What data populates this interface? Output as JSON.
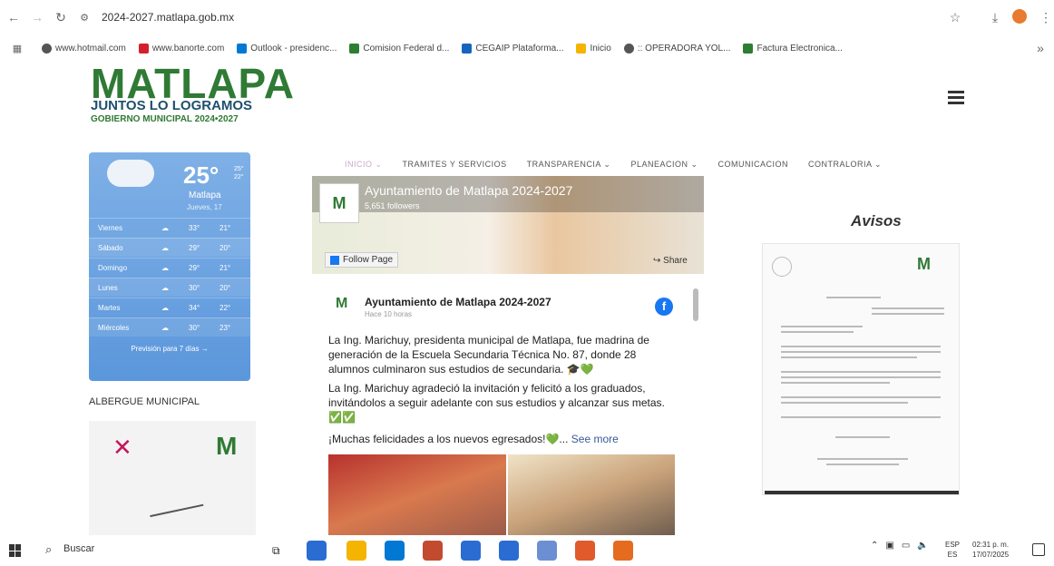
{
  "browser": {
    "url": "2024-2027.matlapa.gob.mx",
    "bookmarks": [
      {
        "label": "www.hotmail.com",
        "color": "#555555"
      },
      {
        "label": "www.banorte.com",
        "color": "#d4202c"
      },
      {
        "label": "Outlook - presidenc...",
        "color": "#0078d4"
      },
      {
        "label": "Comision Federal d...",
        "color": "#2e7d32"
      },
      {
        "label": "CEGAIP Plataforma...",
        "color": "#1565c0"
      },
      {
        "label": "Inicio",
        "color": "#f4b400"
      },
      {
        "label": ":: OPERADORA YOL...",
        "color": "#555555"
      },
      {
        "label": "Factura Electronica...",
        "color": "#2e7d32"
      }
    ]
  },
  "site": {
    "logo_main": "MATLAPA",
    "logo_sub": "JUNTOS LO LOGRAMOS",
    "logo_sub2": "GOBIERNO MUNICIPAL 2024•2027",
    "nav": [
      "INICIO ⌄",
      "TRAMITES Y SERVICIOS",
      "TRANSPARENCIA ⌄",
      "PLANEACION ⌄",
      "COMUNICACION",
      "CONTRALORIA ⌄"
    ]
  },
  "weather": {
    "temp": "25°",
    "temp_max": "25°",
    "temp_min": "22°",
    "city": "Matlapa",
    "day": "Jueves, 17",
    "rows": [
      {
        "day": "Viernes",
        "max": "33°",
        "min": "21°"
      },
      {
        "day": "Sábado",
        "max": "29°",
        "min": "20°"
      },
      {
        "day": "Domingo",
        "max": "29°",
        "min": "21°"
      },
      {
        "day": "Lunes",
        "max": "30°",
        "min": "20°"
      },
      {
        "day": "Martes",
        "max": "34°",
        "min": "22°"
      },
      {
        "day": "Miércoles",
        "max": "30°",
        "min": "23°"
      }
    ],
    "footer": "Previsión para 7 días →"
  },
  "albergue": "ALBERGUE MUNICIPAL",
  "facebook": {
    "page_name": "Ayuntamiento de Matlapa 2024-2027",
    "followers": "5,651 followers",
    "follow_label": "Follow Page",
    "share_label": "Share",
    "logo_letter": "M",
    "post": {
      "author": "Ayuntamiento de Matlapa 2024-2027",
      "time": "Hace 10 horas",
      "p1": "La Ing. Marichuy, presidenta municipal de Matlapa, fue madrina de generación de la Escuela Secundaria Técnica No. 87, donde 28 alumnos culminaron sus estudios de secundaria. 🎓💚",
      "p2": "La Ing. Marichuy agradeció la invitación y felicitó a los graduados, invitándolos a seguir adelante con sus estudios y alcanzar sus metas. ✅✅",
      "p3": "¡Muchas felicidades a los nuevos egresados!💚...",
      "see_more": "See more"
    }
  },
  "avisos": {
    "title": "Avisos",
    "logo": "M"
  },
  "taskbar": {
    "search": "Buscar",
    "lang_top": "ESP",
    "lang_bottom": "ES",
    "time": "02:31 p. m.",
    "date": "17/07/2025",
    "apps": [
      "#2b6cd3",
      "#f4b400",
      "#0078d4",
      "#c24b2f",
      "#2b6cd3",
      "#2b6cd3",
      "#6c8fd3",
      "#e05a2b",
      "#e56b1f"
    ]
  }
}
